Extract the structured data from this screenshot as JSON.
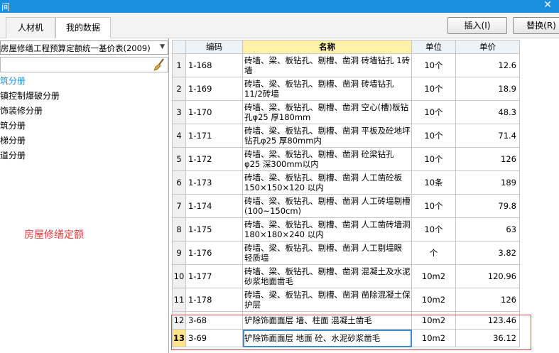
{
  "window": {
    "title": "间",
    "close_glyph": "✕"
  },
  "tabs": [
    {
      "label": "人材机"
    },
    {
      "label": "我的数据"
    }
  ],
  "toolbar": {
    "insert_label": "插入(I)",
    "replace_label": "替换(R)"
  },
  "left_panel": {
    "combo_value": "房屋修缮工程预算定额统一基价表(2009)",
    "tree": [
      {
        "label": "筑分册",
        "selected": true
      },
      {
        "label": "镇控制爆破分册"
      },
      {
        "label": "饰装修分册"
      },
      {
        "label": "筑分册"
      },
      {
        "label": "梯分册"
      },
      {
        "label": "道分册"
      }
    ],
    "annotation": "房屋修缮定额"
  },
  "table": {
    "headers": {
      "code": "编码",
      "name": "名称",
      "unit": "单位",
      "price": "单价"
    },
    "rows": [
      {
        "idx": "1",
        "code": "1-168",
        "name": "砖墙、梁、板钻孔、剔槽、凿洞 砖墙钻孔 1砖墙",
        "unit": "10个",
        "price": "12.6"
      },
      {
        "idx": "2",
        "code": "1-169",
        "name": "砖墙、梁、板钻孔、剔槽、凿洞 砖墙钻孔 11/2砖墙",
        "unit": "10个",
        "price": "18.9"
      },
      {
        "idx": "3",
        "code": "1-170",
        "name": "砖墙、梁、板钻孔、剔槽、凿洞 空心(槽)板钻孔φ25 厚180mm",
        "unit": "10个",
        "price": "48.3"
      },
      {
        "idx": "4",
        "code": "1-171",
        "name": "砖墙、梁、板钻孔、剔槽、凿洞 平板及砼地坪 钻孔φ25 厚80mm内",
        "unit": "10个",
        "price": "71.4"
      },
      {
        "idx": "5",
        "code": "1-172",
        "name": "砖墙、梁、板钻孔、剔槽、凿洞 砼梁钻孔 φ25 深300mm以内",
        "unit": "10个",
        "price": "126"
      },
      {
        "idx": "6",
        "code": "1-173",
        "name": "砖墙、梁、板钻孔、剔槽、凿洞 人工凿砼板 150×150×120 以内",
        "unit": "10条",
        "price": "189"
      },
      {
        "idx": "7",
        "code": "1-174",
        "name": "砖墙、梁、板钻孔、剔槽、凿洞 人工砖墙剔槽 (100~150cm)",
        "unit": "10个",
        "price": "79.8"
      },
      {
        "idx": "8",
        "code": "1-175",
        "name": "砖墙、梁、板钻孔、剔槽、凿洞 人工凿砖墙洞 180×180×240 以内",
        "unit": "10个",
        "price": "63"
      },
      {
        "idx": "9",
        "code": "1-176",
        "name": "砖墙、梁、板钻孔、剔槽、凿洞 人工剔墙眼 轻质墙",
        "unit": "个",
        "price": "3.82"
      },
      {
        "idx": "10",
        "code": "1-177",
        "name": "砖墙、梁、板钻孔、剔槽、凿洞 混凝土及水泥砂浆地面凿毛",
        "unit": "10m2",
        "price": "120.96"
      },
      {
        "idx": "11",
        "code": "1-178",
        "name": "砖墙、梁、板钻孔、剔槽、凿洞 凿除混凝土保护层",
        "unit": "10m2",
        "price": "126"
      },
      {
        "idx": "12",
        "code": "3-68",
        "name": "铲除饰面面层 墙、柱面 混凝土凿毛",
        "unit": "10m2",
        "price": "123.46"
      },
      {
        "idx": "13",
        "code": "3-69",
        "name": "铲除饰面面层 地面 砼、水泥砂浆凿毛",
        "unit": "10m2",
        "price": "36.12"
      }
    ]
  },
  "colors": {
    "accent": "#1a8fe0",
    "highlight_header": "#fff2a8",
    "annotation": "#e04040",
    "current_row": "#ffe38a"
  }
}
